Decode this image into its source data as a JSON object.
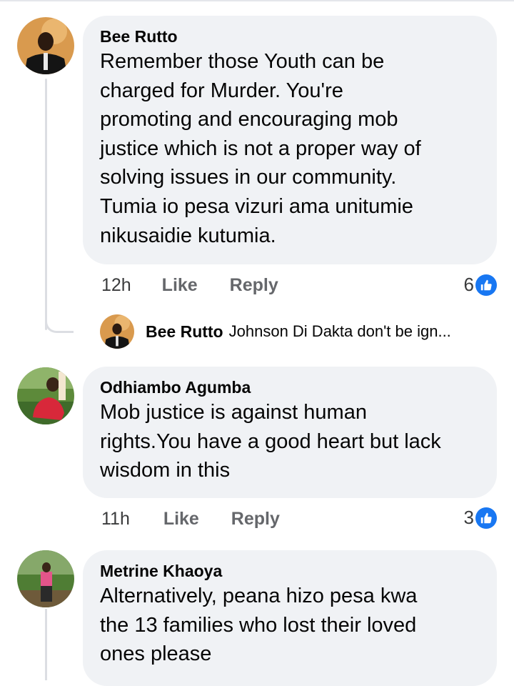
{
  "comments": [
    {
      "author": "Bee Rutto",
      "lines": [
        "Remember those Youth can be",
        "charged for Murder.  You're",
        "promoting and encouraging mob",
        "justice which is not a  proper way of",
        "solving issues in our community.",
        "Tumia io pesa vizuri ama unitumie",
        "nikusaidie kutumia."
      ],
      "time": "12h",
      "like_label": "Like",
      "reply_label": "Reply",
      "reaction_count": "6",
      "reaction_icon": "thumbs-up-icon"
    },
    {
      "author": "Odhiambo Agumba",
      "lines": [
        "Mob justice is against human",
        "rights.You have a good heart but lack",
        "wisdom in this"
      ],
      "time": "11h",
      "like_label": "Like",
      "reply_label": "Reply",
      "reaction_count": "3",
      "reaction_icon": "thumbs-up-icon"
    },
    {
      "author": "Metrine Khaoya",
      "lines": [
        "Alternatively, peana hizo pesa kwa",
        "the 13 families who lost their loved",
        "ones please"
      ]
    }
  ],
  "reply_preview": {
    "author": "Bee Rutto",
    "text": "Johnson Di Dakta don't be ign..."
  },
  "colors": {
    "bubble": "#f0f2f5",
    "meta_text": "#65676b",
    "like_blue": "#1877f2",
    "thread_line": "#dcdee3"
  }
}
